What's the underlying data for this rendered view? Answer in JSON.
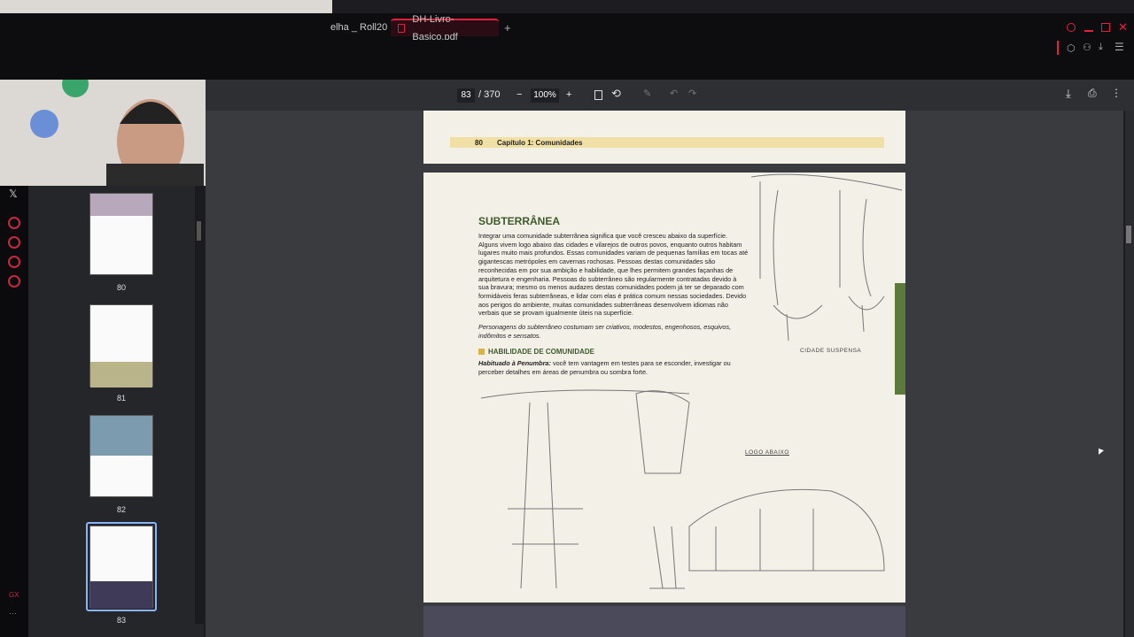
{
  "browser": {
    "tabs": [
      {
        "label": "elha _ Roll20"
      },
      {
        "label": "DH-Livro-Basico.pdf"
      }
    ],
    "new_tab": "+"
  },
  "gx": {
    "bottom_label": "GX"
  },
  "pdf": {
    "current_page": "83",
    "total_pages": "/ 370",
    "zoom": "100%",
    "zoom_out": "−",
    "zoom_in": "+"
  },
  "thumbnails": [
    {
      "label": "80"
    },
    {
      "label": "81"
    },
    {
      "label": "82"
    },
    {
      "label": "83"
    }
  ],
  "doc": {
    "prev_page": {
      "number": "80",
      "chapter": "Capítulo 1: Comunidades"
    },
    "section_title": "SUBTERRÂNEA",
    "body": "Integrar uma comunidade subterrânea significa que você cresceu abaixo da superfície. Alguns vivem logo abaixo das cidades e vilarejos de outros povos, enquanto outros habitam lugares muito mais profundos. Essas comunidades variam de pequenas famílias em tocas até gigantescas metrópoles em cavernas rochosas. Pessoas destas comunidades são reconhecidas em por sua ambição e habilidade, que lhes permitem grandes façanhas de arquitetura e engenharia. Pessoas do subterrâneo são regularmente contratadas devido à sua bravura; mesmo os menos audazes destas comunidades podem já ter se deparado com formidáveis feras subterrâneas, e lidar com elas é prática comum nessas sociedades. Devido aos perigos do ambiente, muitas comunidades subterrâneas desenvolvem idiomas não verbais que se provam igualmente úteis na superfície.",
    "italic": "Personagens do subterrâneo costumam ser criativos, modestos, engenhosos, esquivos, indômitos e sensatos.",
    "ability_title": "HABILIDADE DE COMUNIDADE",
    "ability_name": "Habituado à Penumbra:",
    "ability_text": "você tem vantagem em testes para se esconder, investigar ou perceber detalhes em áreas de penumbra ou sombra forte.",
    "sketch_labels": {
      "cidade": "CIDADE SUSPENSA",
      "logo": "LOGO ABAIXO"
    }
  }
}
